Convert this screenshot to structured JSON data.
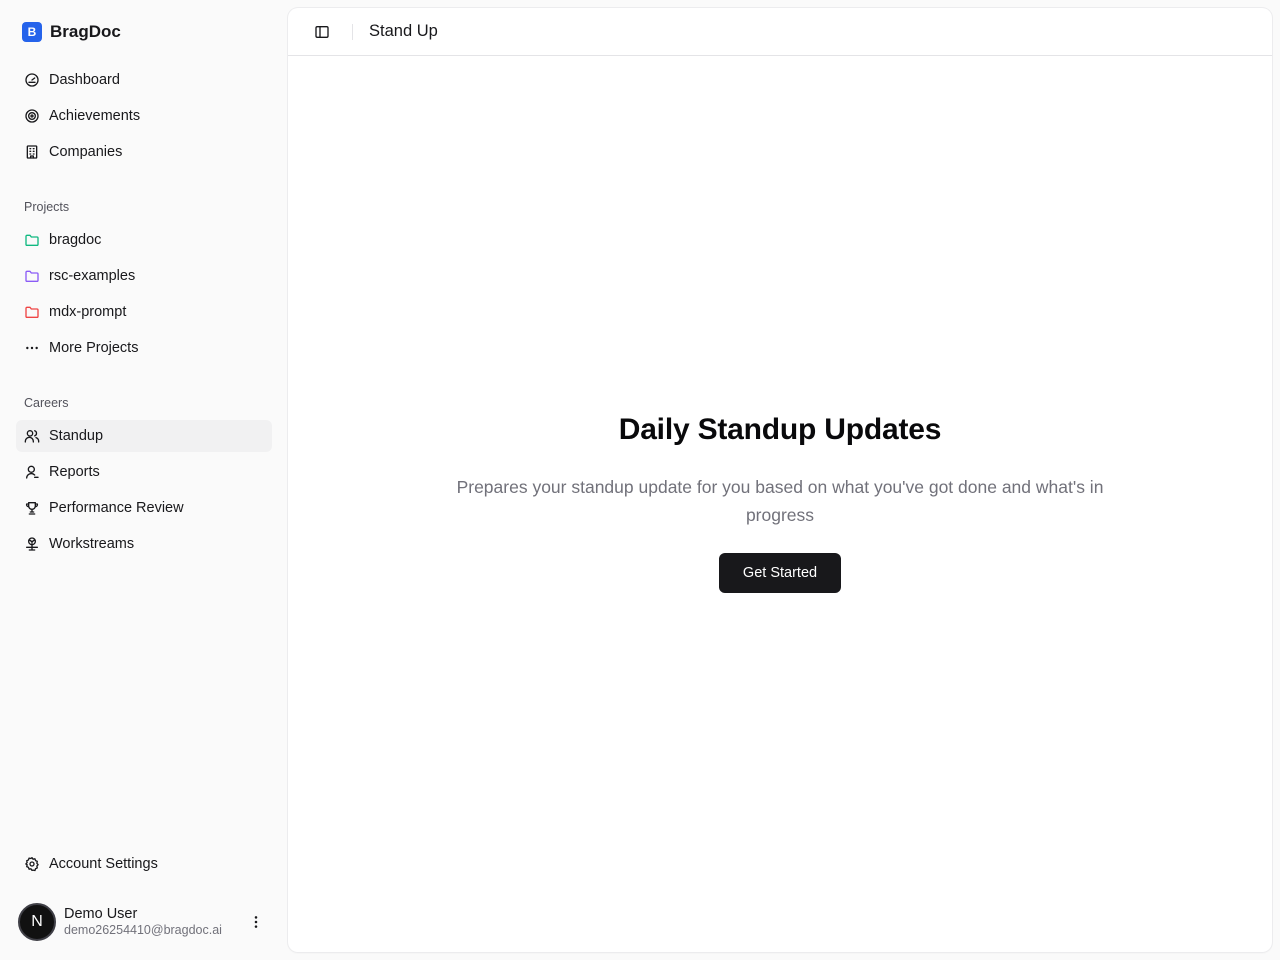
{
  "app": {
    "name": "BragDoc",
    "logo_letter": "B",
    "accent": "#2563eb"
  },
  "sidebar": {
    "main_items": [
      {
        "label": "Dashboard",
        "icon": "gauge-icon"
      },
      {
        "label": "Achievements",
        "icon": "target-icon"
      },
      {
        "label": "Companies",
        "icon": "building-icon"
      }
    ],
    "projects_label": "Projects",
    "projects": [
      {
        "label": "bragdoc",
        "icon": "folder-icon",
        "color": "#10b981"
      },
      {
        "label": "rsc-examples",
        "icon": "folder-icon",
        "color": "#8b5cf6"
      },
      {
        "label": "mdx-prompt",
        "icon": "folder-icon",
        "color": "#ef4444"
      },
      {
        "label": "More Projects",
        "icon": "more-horizontal-icon"
      }
    ],
    "careers_label": "Careers",
    "careers": [
      {
        "label": "Standup",
        "icon": "users-icon",
        "active": true
      },
      {
        "label": "Reports",
        "icon": "user-icon"
      },
      {
        "label": "Performance Review",
        "icon": "trophy-icon"
      },
      {
        "label": "Workstreams",
        "icon": "network-icon"
      }
    ],
    "account_settings": {
      "label": "Account Settings",
      "icon": "gear-icon"
    },
    "user": {
      "initial": "N",
      "name": "Demo User",
      "email": "demo26254410@bragdoc.ai"
    }
  },
  "header": {
    "title": "Stand Up"
  },
  "hero": {
    "title": "Daily Standup Updates",
    "subtitle": "Prepares your standup update for you based on what you've got done and what's in progress",
    "cta_label": "Get Started"
  }
}
